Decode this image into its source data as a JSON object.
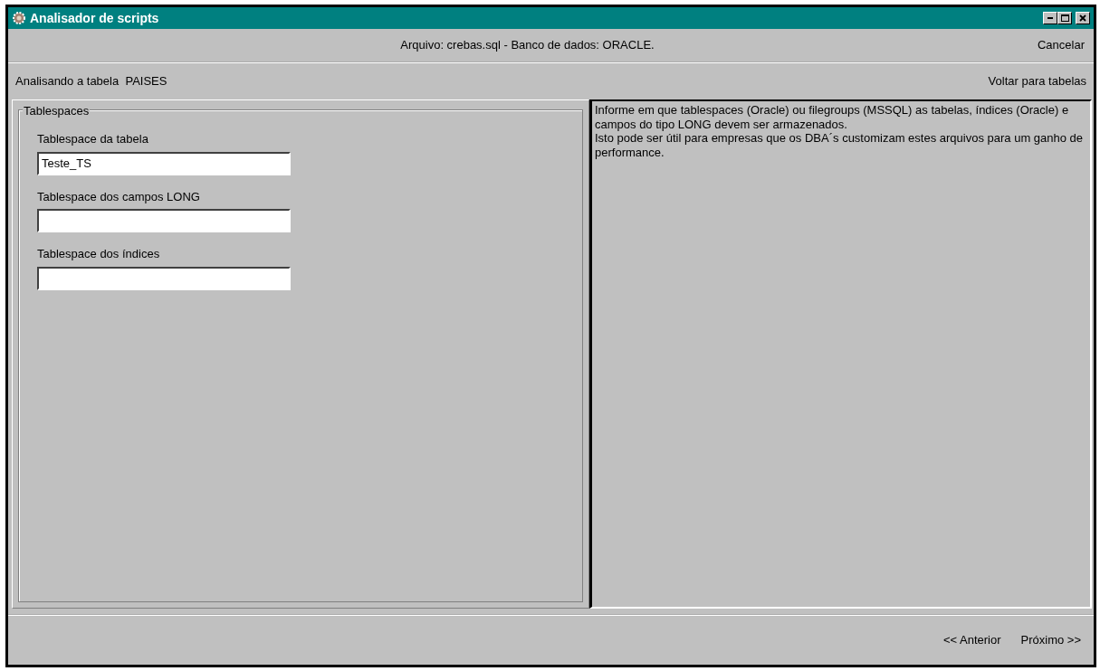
{
  "window": {
    "title": "Analisador de scripts"
  },
  "header": {
    "file_info": "Arquivo: crebas.sql - Banco de dados: ORACLE.",
    "cancel": "Cancelar"
  },
  "status": {
    "text": "Analisando a tabela  PAISES",
    "back_link": "Voltar para tabelas"
  },
  "group": {
    "title": "Tablespaces",
    "fields": [
      {
        "label": "Tablespace da tabela",
        "value": "Teste_TS"
      },
      {
        "label": "Tablespace dos campos LONG"
      },
      {
        "label": "Tablespace dos índices"
      }
    ]
  },
  "help": "Informe em que tablespaces (Oracle) ou filegroups (MSSQL) as tabelas, índices (Oracle) e campos do tipo LONG devem ser armazenados.\nIsto pode ser útil para empresas que os DBA´s customizam estes arquivos para um ganho de performance.",
  "footer": {
    "buttons": [
      "<< Anterior",
      "Próximo >>"
    ]
  }
}
